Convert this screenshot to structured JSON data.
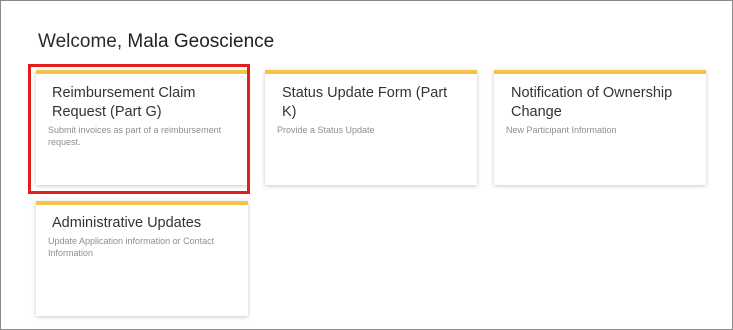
{
  "header": {
    "welcome_prefix": "Welcome,",
    "user_name": "Mala Geoscience"
  },
  "cards": [
    {
      "title": "Reimbursement Claim Request (Part G)",
      "description": "Submit invoices as part of a reimbursement request.",
      "highlighted": true
    },
    {
      "title": "Status Update Form (Part K)",
      "description": "Provide a Status Update",
      "highlighted": false
    },
    {
      "title": "Notification of Ownership Change",
      "description": "New Participant Information",
      "highlighted": false
    },
    {
      "title": "Administrative Updates",
      "description": "Update Application information or Contact Information",
      "highlighted": false
    }
  ],
  "colors": {
    "card_accent": "#f5c24a",
    "highlight_border": "#e02020",
    "description_text": "#8f8f8f"
  }
}
